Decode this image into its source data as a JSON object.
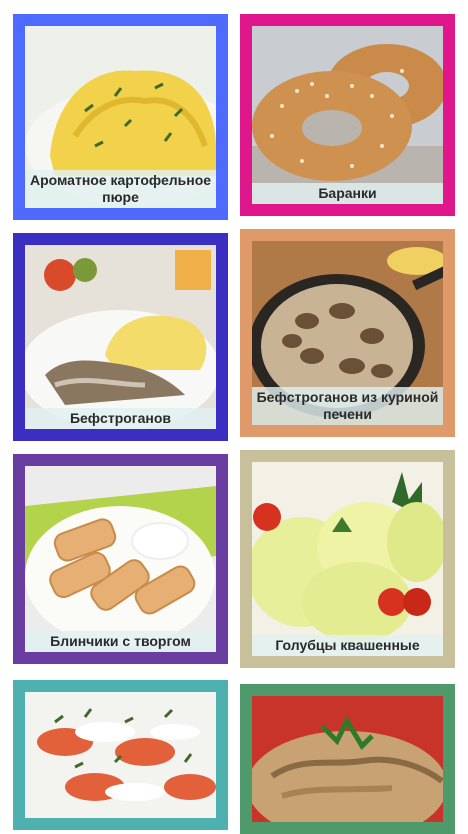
{
  "recipes": [
    {
      "title": "Ароматное картофельное пюре",
      "border_color": "#4f6bff",
      "photo": "mashed-potatoes-photo"
    },
    {
      "title": "Баранки",
      "border_color": "#e0178c",
      "photo": "bagels-photo"
    },
    {
      "title": "Бефстроганов",
      "border_color": "#3a2fc0",
      "photo": "beef-stroganoff-photo"
    },
    {
      "title": "Бефстроганов из куриной печени",
      "border_color": "#e09a6a",
      "photo": "chicken-liver-stroganoff-photo"
    },
    {
      "title": "Блинчики с творгом",
      "border_color": "#6a3ea0",
      "photo": "pancakes-with-cottage-cheese-photo"
    },
    {
      "title": "Голубцы квашенные",
      "border_color": "#c8c09a",
      "photo": "cabbage-rolls-photo"
    },
    {
      "title": "",
      "border_color": "#4fb0b0",
      "photo": "dumplings-with-dill-photo"
    },
    {
      "title": "",
      "border_color": "#4f9a6a",
      "photo": "stewed-cabbage-photo"
    }
  ]
}
